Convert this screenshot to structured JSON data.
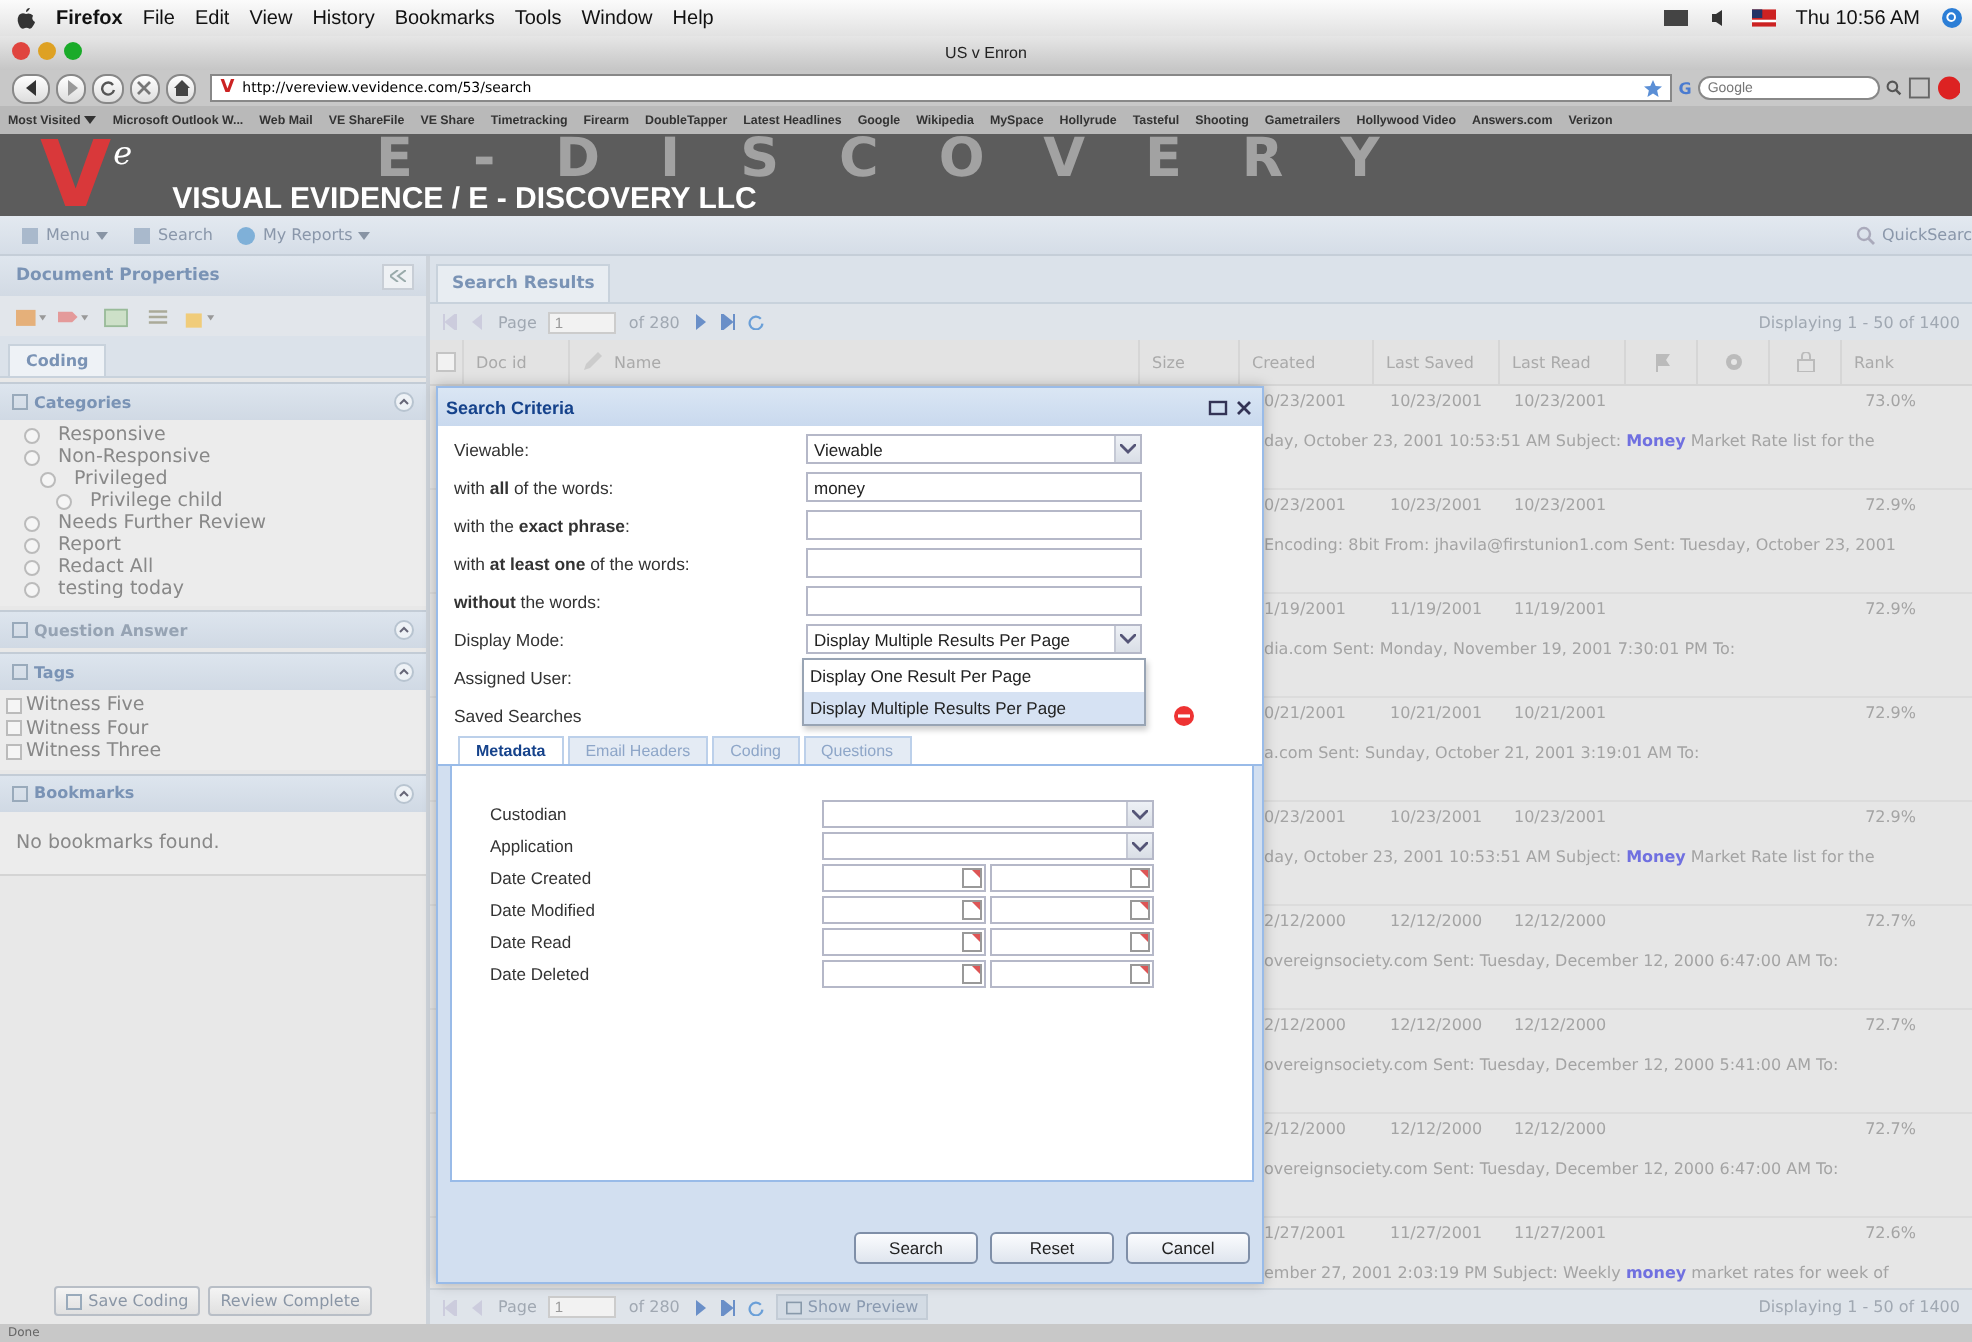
{
  "menubar": {
    "app": "Firefox",
    "items": [
      "File",
      "Edit",
      "View",
      "History",
      "Bookmarks",
      "Tools",
      "Window",
      "Help"
    ],
    "clock": "Thu 10:56 AM"
  },
  "window": {
    "title": "US v Enron"
  },
  "navbar": {
    "favicon": "V",
    "url": "http://vereview.vevidence.com/53/search",
    "search": {
      "engine_letter": "G",
      "placeholder": "Google"
    }
  },
  "bookmarks_bar": [
    {
      "label": "Most Visited",
      "dropdown": true
    },
    {
      "label": "Microsoft Outlook W...",
      "dropdown": false
    },
    {
      "label": "Web Mail",
      "dropdown": false
    },
    {
      "label": "VE ShareFile",
      "dropdown": false
    },
    {
      "label": "VE Share",
      "dropdown": false
    },
    {
      "label": "Timetracking",
      "dropdown": false
    },
    {
      "label": "Firearm",
      "dropdown": false
    },
    {
      "label": "DoubleTapper",
      "dropdown": false
    },
    {
      "label": "Latest Headlines",
      "dropdown": false
    },
    {
      "label": "Google",
      "dropdown": false
    },
    {
      "label": "Wikipedia",
      "dropdown": false
    },
    {
      "label": "MySpace",
      "dropdown": false
    },
    {
      "label": "Hollyrude",
      "dropdown": false
    },
    {
      "label": "Tasteful",
      "dropdown": false
    },
    {
      "label": "Shooting",
      "dropdown": false
    },
    {
      "label": "Gametrailers",
      "dropdown": false
    },
    {
      "label": "Hollywood Video",
      "dropdown": false
    },
    {
      "label": "Answers.com",
      "dropdown": false
    },
    {
      "label": "Verizon",
      "dropdown": false
    }
  ],
  "banner": {
    "logo_letter": "V",
    "logo_sup": "e",
    "backdrop": "E-DISCOVERY",
    "title": "VISUAL EVIDENCE / E - DISCOVERY LLC"
  },
  "toolbar": {
    "items": [
      {
        "label": "Menu",
        "dropdown": true
      },
      {
        "label": "Search",
        "dropdown": false
      },
      {
        "label": "My Reports",
        "dropdown": true
      }
    ],
    "quicksearch": "QuickSearc"
  },
  "left_panel": {
    "title": "Document Properties",
    "tabs": [
      {
        "label": "Coding",
        "selected": true
      }
    ],
    "sections": [
      {
        "title": "Categories",
        "kind": "radio_list",
        "disabled": false,
        "items": [
          {
            "label": "Responsive",
            "checked": false
          },
          {
            "label": "Non-Responsive",
            "checked": false,
            "children": [
              {
                "label": "Privileged",
                "checked": false,
                "children": [
                  {
                    "label": "Privilege child",
                    "checked": false
                  }
                ]
              }
            ]
          },
          {
            "label": "Needs Further Review",
            "checked": false
          },
          {
            "label": "Report",
            "checked": false
          },
          {
            "label": "Redact All",
            "checked": false
          },
          {
            "label": "testing today",
            "checked": false
          }
        ]
      },
      {
        "title": "Question Answer",
        "kind": "empty",
        "disabled": true
      },
      {
        "title": "Tags",
        "kind": "check_list",
        "disabled": false,
        "items": [
          {
            "label": "Witness Five",
            "checked": false
          },
          {
            "label": "Witness Four",
            "checked": false
          },
          {
            "label": "Witness Three",
            "checked": false
          }
        ]
      },
      {
        "title": "Bookmarks",
        "kind": "message",
        "disabled": false,
        "message": "No bookmarks found."
      }
    ],
    "buttons": [
      "Save Coding",
      "Review Complete"
    ]
  },
  "results": {
    "tab": {
      "label": "Search Results",
      "selected": true
    },
    "select_all": {
      "checked": false
    },
    "paging": {
      "page_label": "Page",
      "page": "1",
      "of": "of 280",
      "display": "Displaying 1 - 50 of 1400"
    },
    "columns": [
      "Doc id",
      "Name",
      "Size",
      "Created",
      "Last Saved",
      "Last Read",
      "Rank"
    ],
    "rows": [
      {
        "created": "0/23/2001",
        "last_saved": "10/23/2001",
        "last_read": "10/23/2001",
        "rank": "73.0%",
        "snippet": "day, October 23, 2001 10:53:51 AM Subject: **Money** Market Rate list for the"
      },
      {
        "created": "0/23/2001",
        "last_saved": "10/23/2001",
        "last_read": "10/23/2001",
        "rank": "72.9%",
        "snippet": "Encoding: 8bit From: jhavila@firstunion1.com Sent: Tuesday, October 23, 2001"
      },
      {
        "created": "1/19/2001",
        "last_saved": "11/19/2001",
        "last_read": "11/19/2001",
        "rank": "72.9%",
        "snippet": "dia.com Sent: Monday, November 19, 2001 7:30:01 PM To:"
      },
      {
        "created": "0/21/2001",
        "last_saved": "10/21/2001",
        "last_read": "10/21/2001",
        "rank": "72.9%",
        "snippet": "a.com Sent: Sunday, October 21, 2001 3:19:01 AM To:"
      },
      {
        "created": "0/23/2001",
        "last_saved": "10/23/2001",
        "last_read": "10/23/2001",
        "rank": "72.9%",
        "snippet": "day, October 23, 2001 10:53:51 AM Subject: **Money** Market Rate list for the"
      },
      {
        "created": "2/12/2000",
        "last_saved": "12/12/2000",
        "last_read": "12/12/2000",
        "rank": "72.7%",
        "snippet": "overeignsociety.com Sent: Tuesday, December 12, 2000 6:47:00 AM To:"
      },
      {
        "created": "2/12/2000",
        "last_saved": "12/12/2000",
        "last_read": "12/12/2000",
        "rank": "72.7%",
        "snippet": "overeignsociety.com Sent: Tuesday, December 12, 2000 5:41:00 AM To:"
      },
      {
        "created": "2/12/2000",
        "last_saved": "12/12/2000",
        "last_read": "12/12/2000",
        "rank": "72.7%",
        "snippet": "overeignsociety.com Sent: Tuesday, December 12, 2000 6:47:00 AM To:"
      },
      {
        "created": "1/27/2001",
        "last_saved": "11/27/2001",
        "last_read": "11/27/2001",
        "rank": "72.6%",
        "snippet": "ember 27, 2001 2:03:19 PM Subject: Weekly **money** market rates for week of"
      }
    ],
    "bottom_paging": {
      "page_label": "Page",
      "page": "1",
      "of": "of 280",
      "show_preview": "Show Preview",
      "display": "Displaying 1 - 50 of 1400"
    }
  },
  "dialog": {
    "title": "Search Criteria",
    "fields": [
      {
        "label": "Viewable:",
        "kind": "select",
        "value": "Viewable"
      },
      {
        "label": "with **all** of the words:",
        "kind": "text",
        "value": "money"
      },
      {
        "label": "with the **exact phrase**:",
        "kind": "text"
      },
      {
        "label": "with **at least one** of the words:",
        "kind": "text"
      },
      {
        "label": "**without** the words:",
        "kind": "text"
      },
      {
        "label": "Display Mode:",
        "kind": "select",
        "value": "Display Multiple Results Per Page"
      },
      {
        "label": "Assigned User:",
        "kind": "covered"
      },
      {
        "label": "Saved Searches",
        "kind": "saved"
      }
    ],
    "dropdown": [
      {
        "label": "Display One Result Per Page",
        "selected": false
      },
      {
        "label": "Display Multiple Results Per Page",
        "selected": true
      }
    ],
    "tabs": [
      {
        "label": "Metadata",
        "selected": true
      },
      {
        "label": "Email Headers",
        "selected": false
      },
      {
        "label": "Coding",
        "selected": false
      },
      {
        "label": "Questions",
        "selected": false
      }
    ],
    "metadata_fields": [
      {
        "label": "Custodian",
        "kind": "select"
      },
      {
        "label": "Application",
        "kind": "select"
      },
      {
        "label": "Date Created",
        "kind": "date_range"
      },
      {
        "label": "Date Modified",
        "kind": "date_range"
      },
      {
        "label": "Date Read",
        "kind": "date_range"
      },
      {
        "label": "Date Deleted",
        "kind": "date_range"
      }
    ],
    "buttons": [
      "Search",
      "Reset",
      "Cancel"
    ]
  },
  "status_bar": "Done"
}
